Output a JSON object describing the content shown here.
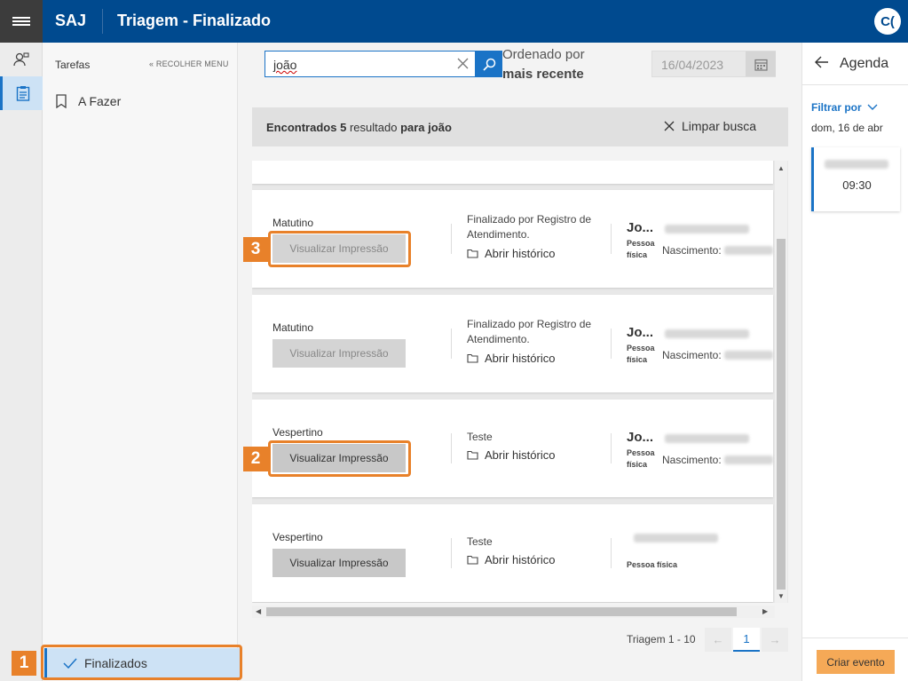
{
  "app": {
    "brand": "SAJ",
    "title": "Triagem - Finalizado",
    "user_initials": "C("
  },
  "sidebar": {
    "title": "Tarefas",
    "collapse_label": "« RECOLHER MENU",
    "items": [
      {
        "label": "A Fazer"
      }
    ],
    "active_item": "Finalizados"
  },
  "search": {
    "value": "joão"
  },
  "order": {
    "label": "Ordenado por",
    "value": "mais recente"
  },
  "date_filter": {
    "value": "16/04/2023"
  },
  "results": {
    "prefix": "Encontrados",
    "count": "5",
    "word": "resultado",
    "for": "para",
    "query": "joão",
    "clear_label": "Limpar busca"
  },
  "records": [
    {
      "period": "Matutino",
      "button": "Visualizar Impressão",
      "status": "Finalizado por Registro de Atendimento.",
      "history": "Abrir histórico",
      "name": "Jo...",
      "person_type": "Pessoa física",
      "birth_label": "Nascimento:"
    },
    {
      "period": "Matutino",
      "button": "Visualizar Impressão",
      "status": "Finalizado por Registro de Atendimento.",
      "history": "Abrir histórico",
      "name": "Jo...",
      "person_type": "Pessoa física",
      "birth_label": "Nascimento:"
    },
    {
      "period": "Vespertino",
      "button": "Visualizar Impressão",
      "status": "Teste",
      "history": "Abrir histórico",
      "name": "Jo...",
      "person_type": "Pessoa física",
      "birth_label": "Nascimento:"
    },
    {
      "period": "Vespertino",
      "button": "Visualizar Impressão",
      "status": "Teste",
      "history": "Abrir histórico",
      "name": "",
      "person_type": "Pessoa física",
      "birth_label": ""
    }
  ],
  "pagination": {
    "label": "Triagem 1 - 10",
    "prev": "←",
    "current": "1",
    "next": "→"
  },
  "agenda": {
    "title": "Agenda",
    "filter_label": "Filtrar por",
    "date": "dom, 16 de abr",
    "event_time": "09:30",
    "create_label": "Criar evento"
  },
  "callouts": [
    "1",
    "2",
    "3"
  ],
  "colors": {
    "primary": "#004a8f",
    "accent": "#1a73c6",
    "callout": "#e8812a",
    "create": "#f5a957"
  },
  "icons": [
    "menu-icon",
    "person-icon",
    "clipboard-icon",
    "bookmark-icon",
    "check-icon",
    "close-icon",
    "search-icon",
    "calendar-icon",
    "folder-icon",
    "arrow-left-icon",
    "chevron-down-icon"
  ]
}
